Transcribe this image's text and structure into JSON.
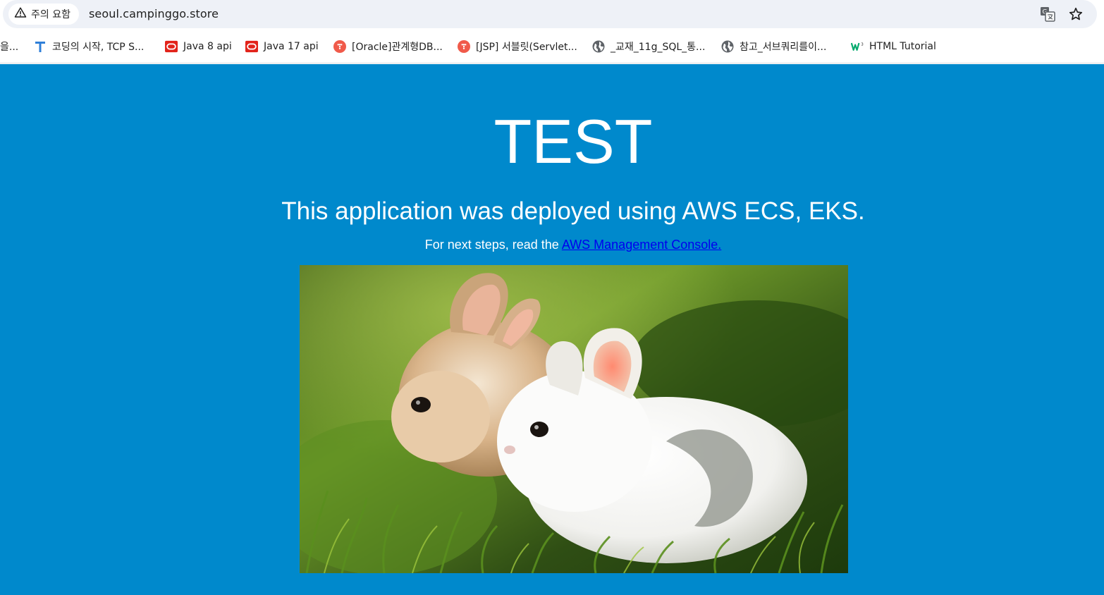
{
  "browser": {
    "security_label": "주의 요함",
    "url": "seoul.campinggo.store",
    "icons": {
      "security": "warning-icon",
      "translate": "translate-icon",
      "bookmark": "star-icon"
    }
  },
  "bookmarks": [
    {
      "label": "을...",
      "icon": "none"
    },
    {
      "label": "코딩의 시작, TCP S...",
      "icon": "tistory-t-icon"
    },
    {
      "label": "Java 8 api",
      "icon": "oracle-icon"
    },
    {
      "label": "Java 17 api",
      "icon": "oracle-icon"
    },
    {
      "label": "[Oracle]관계형DB...",
      "icon": "red-dots-icon"
    },
    {
      "label": "[JSP] 서블릿(Servlet...",
      "icon": "red-dots-icon"
    },
    {
      "label": "_교재_11g_SQL_통...",
      "icon": "globe-icon"
    },
    {
      "label": "참고_서브쿼리를이...",
      "icon": "globe-icon"
    },
    {
      "label": "HTML Tutorial",
      "icon": "w3schools-icon"
    }
  ],
  "page": {
    "title": "TEST",
    "subtitle": "This application was deployed using AWS ECS, EKS.",
    "steps_text": "For next steps, read the ",
    "link_text": "AWS Management Console.",
    "image_alt": "two rabbits in grass",
    "colors": {
      "background": "#0089cc",
      "text": "#ffffff",
      "link": "#0000ee"
    }
  }
}
